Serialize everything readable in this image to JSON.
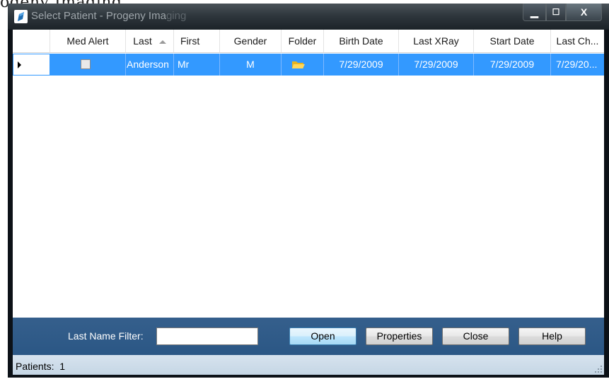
{
  "background": {
    "partial_text": "ogeny Imaging"
  },
  "window": {
    "title_main": "Select Patient - Progeny Ima",
    "title_fade": "ging",
    "controls": {
      "minimize": "▁",
      "maximize": "☐",
      "close": "X"
    }
  },
  "grid": {
    "columns": [
      {
        "key": "med_alert",
        "label": "Med Alert"
      },
      {
        "key": "last",
        "label": "Last",
        "sorted": "ascending"
      },
      {
        "key": "first",
        "label": "First"
      },
      {
        "key": "gender",
        "label": "Gender"
      },
      {
        "key": "folder",
        "label": "Folder"
      },
      {
        "key": "birth_date",
        "label": "Birth Date"
      },
      {
        "key": "last_xray",
        "label": "Last XRay"
      },
      {
        "key": "start_date",
        "label": "Start Date"
      },
      {
        "key": "last_change",
        "label": "Last Ch..."
      }
    ],
    "rows": [
      {
        "selected": true,
        "med_alert": false,
        "last": "Anderson",
        "first": "Mr",
        "gender": "M",
        "folder_icon": "folder-icon",
        "birth_date": "7/29/2009",
        "last_xray": "7/29/2009",
        "start_date": "7/29/2009",
        "last_change": "7/29/20..."
      }
    ]
  },
  "filter": {
    "label": "Last Name Filter:",
    "value": "",
    "placeholder": ""
  },
  "buttons": {
    "open": "Open",
    "properties": "Properties",
    "close": "Close",
    "help": "Help"
  },
  "status": {
    "label": "Patients:",
    "count": "1"
  },
  "colors": {
    "selection": "#3399ff",
    "filter_bar": "#2f5a87",
    "status_bar": "#cfdde9",
    "titlebar": "#2f373d"
  }
}
